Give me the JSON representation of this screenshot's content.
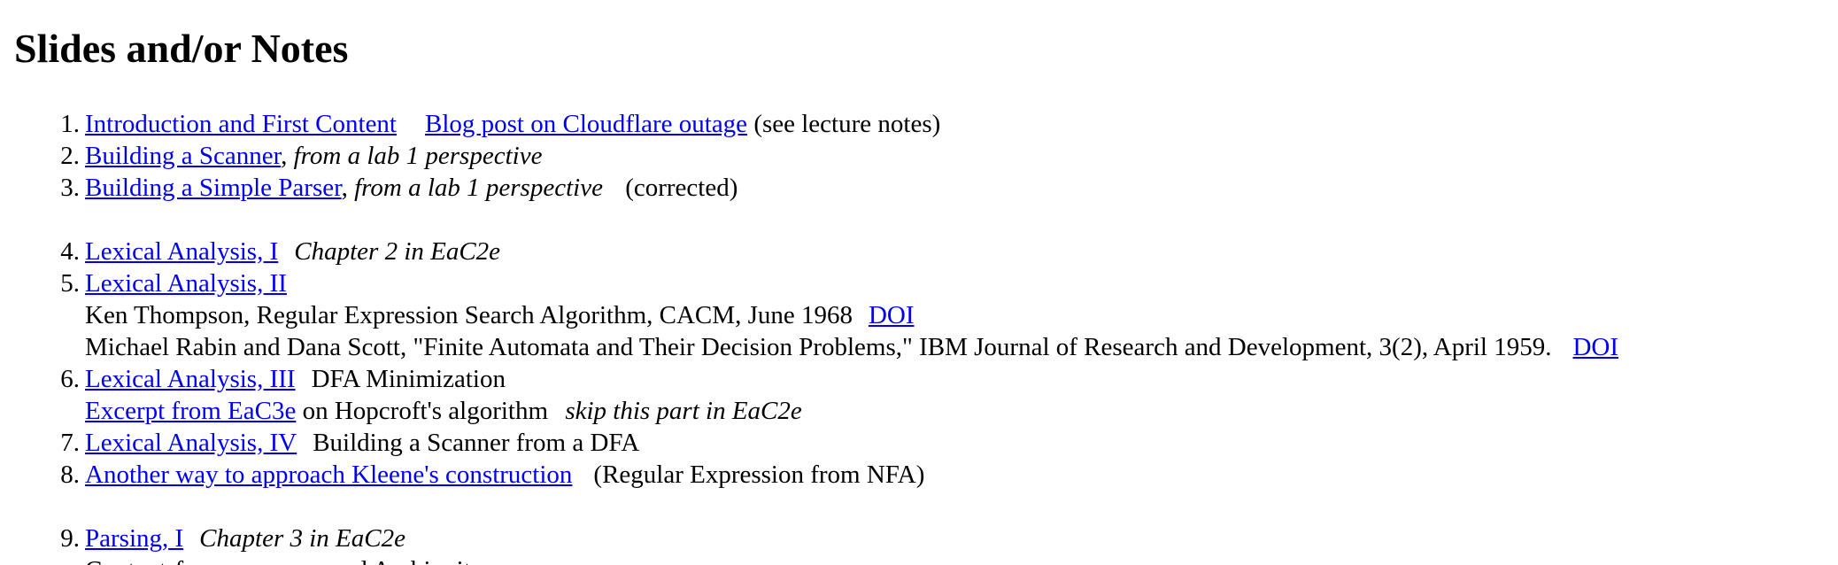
{
  "page_title": "Slides and/or Notes",
  "items": [
    {
      "num": "1.",
      "link1": "Introduction and First Content",
      "link2": "Blog post on Cloudflare outage",
      "note": "(see lecture notes)"
    },
    {
      "num": "2.",
      "link": "Building a Scanner",
      "comma": ",",
      "italic": "from a lab 1 perspective"
    },
    {
      "num": "3.",
      "link": "Building a Simple Parser",
      "comma": ",",
      "italic": "from a lab 1 perspective",
      "note": "(corrected)"
    },
    {
      "num": "4.",
      "link": "Lexical Analysis, I",
      "italic": "Chapter 2 in EaC2e"
    },
    {
      "num": "5.",
      "link": "Lexical Analysis, II",
      "ref1_text": "Ken Thompson, Regular Expression Search Algorithm, CACM, June 1968",
      "ref1_link": "DOI",
      "ref2_text": "Michael Rabin and Dana Scott, \"Finite Automata and Their Decision Problems,\" IBM Journal of Research and Development, 3(2), April 1959.",
      "ref2_link": "DOI"
    },
    {
      "num": "6.",
      "link": "Lexical Analysis, III",
      "note": "DFA Minimization",
      "sub_link": "Excerpt from EaC3e",
      "sub_text": "on Hopcroft's algorithm",
      "sub_italic": "skip this part in EaC2e"
    },
    {
      "num": "7.",
      "link": "Lexical Analysis, IV",
      "note": "Building a Scanner from a DFA"
    },
    {
      "num": "8.",
      "link": "Another way to approach Kleene's construction",
      "note": "(Regular Expression from NFA)"
    },
    {
      "num": "9.",
      "link": "Parsing, I",
      "italic": "Chapter 3 in EaC2e",
      "sub_text": "Context-free grammars and Ambiguity"
    }
  ]
}
